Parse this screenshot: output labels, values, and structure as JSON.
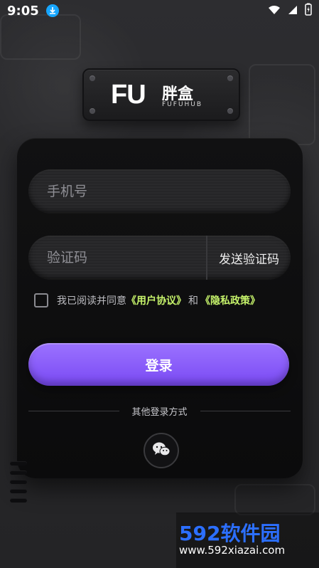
{
  "status_bar": {
    "time": "9:05",
    "icons": [
      "download-icon",
      "wifi-icon",
      "signal-icon",
      "battery-icon"
    ]
  },
  "logo": {
    "text": "FU",
    "name_cn": "胖盒",
    "subtitle": "FUFUHUB"
  },
  "form": {
    "phone_placeholder": "手机号",
    "code_placeholder": "验证码",
    "send_code_label": "发送验证码",
    "agreement": {
      "prefix": "我已阅读并同意",
      "user_agreement": "《用户协议》",
      "and": "和",
      "privacy_policy": "《隐私政策》"
    },
    "login_label": "登录",
    "other_login_label": "其他登录方式"
  },
  "watermark": {
    "main": "592软件园",
    "url": "www.592xiazai.com"
  },
  "colors": {
    "accent": "#8b5cf6",
    "link": "#c6f36b"
  }
}
